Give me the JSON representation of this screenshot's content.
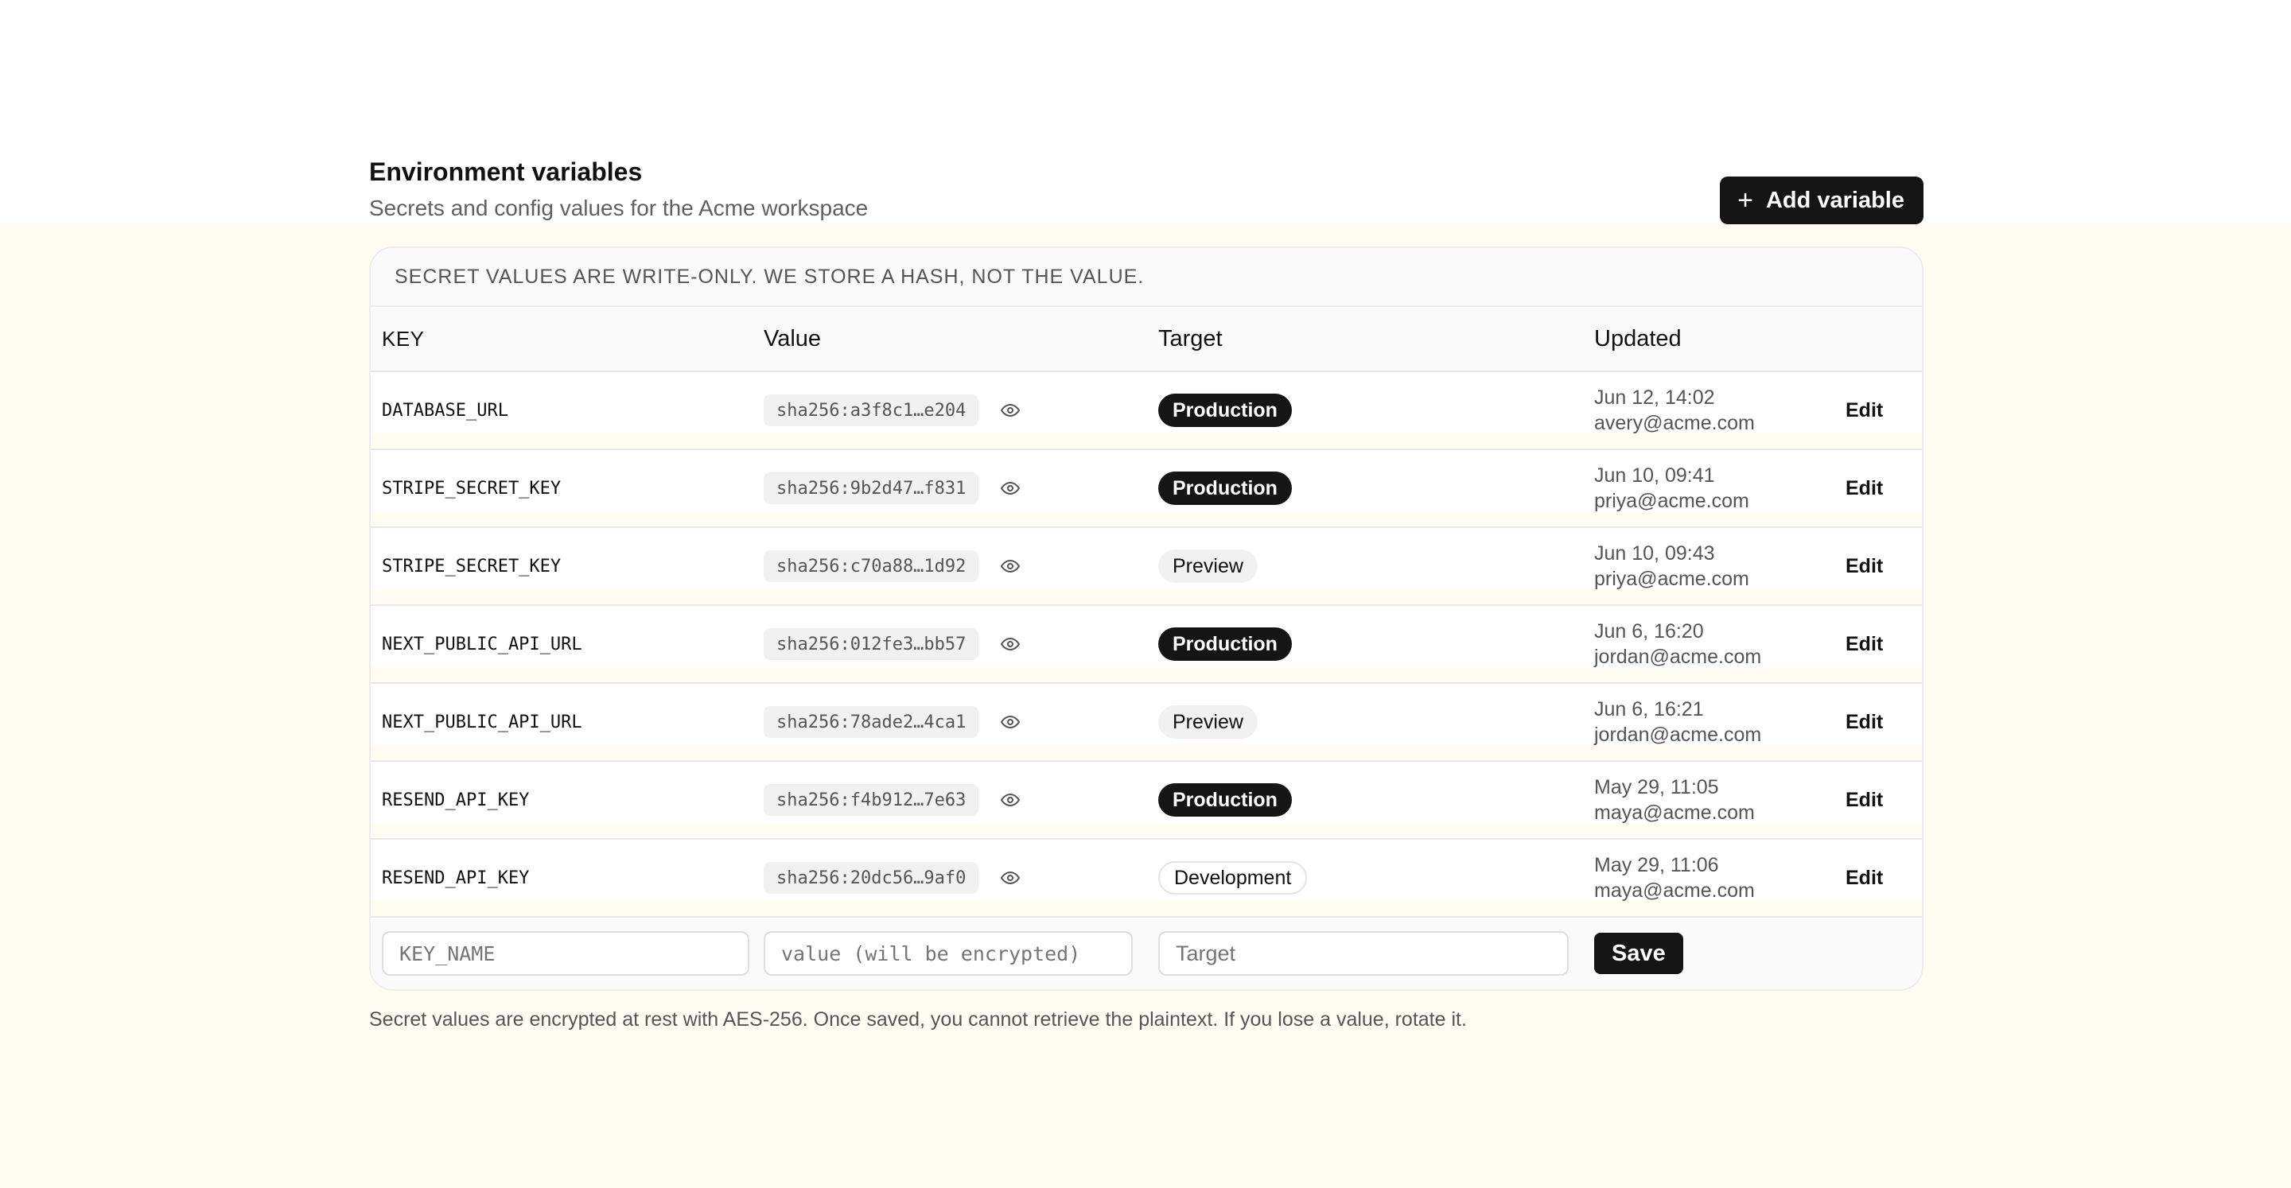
{
  "header": {
    "title": "Environment variables",
    "subtitle": "Secrets and config values for the Acme workspace",
    "add_button": "Add variable",
    "add_icon": "plus-icon"
  },
  "notice": "SECRET VALUES ARE WRITE-ONLY. WE STORE A HASH, NOT THE VALUE.",
  "columns": {
    "key": "KEY",
    "value": "Value",
    "target": "Target",
    "updated": "Updated"
  },
  "rows": [
    {
      "key": "DATABASE_URL",
      "hash": "sha256:a3f8c1…e204",
      "target": "Production",
      "target_style": "dark",
      "time": "Jun 12, 14:02",
      "user": "avery@acme.com",
      "action": "Edit"
    },
    {
      "key": "STRIPE_SECRET_KEY",
      "hash": "sha256:9b2d47…f831",
      "target": "Production",
      "target_style": "dark",
      "time": "Jun 10, 09:41",
      "user": "priya@acme.com",
      "action": "Edit"
    },
    {
      "key": "STRIPE_SECRET_KEY",
      "hash": "sha256:c70a88…1d92",
      "target": "Preview",
      "target_style": "light",
      "time": "Jun 10, 09:43",
      "user": "priya@acme.com",
      "action": "Edit"
    },
    {
      "key": "NEXT_PUBLIC_API_URL",
      "hash": "sha256:012fe3…bb57",
      "target": "Production",
      "target_style": "dark",
      "time": "Jun 6, 16:20",
      "user": "jordan@acme.com",
      "action": "Edit"
    },
    {
      "key": "NEXT_PUBLIC_API_URL",
      "hash": "sha256:78ade2…4ca1",
      "target": "Preview",
      "target_style": "light",
      "time": "Jun 6, 16:21",
      "user": "jordan@acme.com",
      "action": "Edit"
    },
    {
      "key": "RESEND_API_KEY",
      "hash": "sha256:f4b912…7e63",
      "target": "Production",
      "target_style": "dark",
      "time": "May 29, 11:05",
      "user": "maya@acme.com",
      "action": "Edit"
    },
    {
      "key": "RESEND_API_KEY",
      "hash": "sha256:20dc56…9af0",
      "target": "Development",
      "target_style": "outline",
      "time": "May 29, 11:06",
      "user": "maya@acme.com",
      "action": "Edit"
    }
  ],
  "new_row": {
    "key_placeholder": "KEY_NAME",
    "value_placeholder": "value (will be encrypted)",
    "target_placeholder": "Target",
    "save_label": "Save"
  },
  "footnote": "Secret values are encrypted at rest with AES-256. Once saved, you cannot retrieve the plaintext. If you lose a value, rotate it.",
  "colors": {
    "primary": "#151515",
    "background_tint": "#fffdf2",
    "muted_text": "#555555"
  }
}
